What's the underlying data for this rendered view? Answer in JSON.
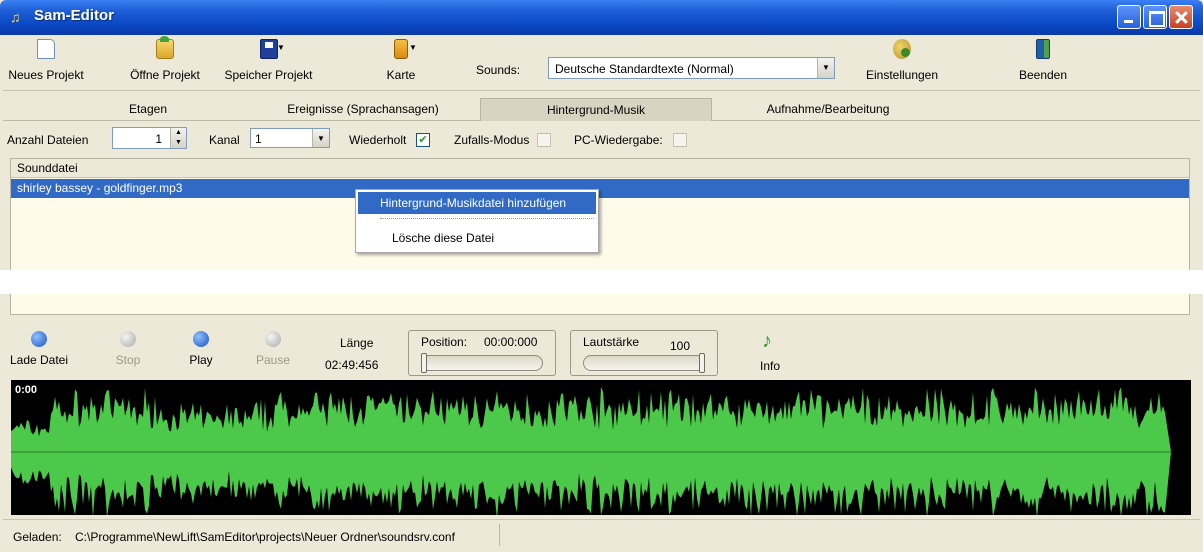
{
  "window": {
    "title": "Sam-Editor",
    "icon": "music-note-icon"
  },
  "toolbar": {
    "new_project": "Neues Projekt",
    "open_project": "Öffne Projekt",
    "save_project": "Speicher Projekt",
    "map": "Karte",
    "sounds_label": "Sounds:",
    "sounds_value": "Deutsche Standardtexte (Normal)",
    "settings": "Einstellungen",
    "exit": "Beenden"
  },
  "tabs": [
    {
      "label": "Etagen",
      "active": false
    },
    {
      "label": "Ereignisse (Sprachansagen)",
      "active": false
    },
    {
      "label": "Hintergrund-Musik",
      "active": true
    },
    {
      "label": "Aufnahme/Bearbeitung",
      "active": false
    }
  ],
  "options": {
    "file_count_label": "Anzahl Dateien",
    "file_count_value": "1",
    "channel_label": "Kanal",
    "channel_value": "1",
    "repeat_label": "Wiederholt",
    "repeat_checked": true,
    "random_label": "Zufalls-Modus",
    "random_checked": false,
    "pc_play_label": "PC-Wiedergabe:",
    "pc_play_checked": false
  },
  "list": {
    "header": "Sounddatei",
    "rows": [
      "shirley bassey - goldfinger.mp3"
    ]
  },
  "context_menu": {
    "items": [
      "Hintergrund-Musikdatei hinzufügen",
      "Lösche diese Datei"
    ]
  },
  "player": {
    "load": "Lade Datei",
    "stop": "Stop",
    "play": "Play",
    "pause": "Pause",
    "length_label": "Länge",
    "length_value": "02:49:456",
    "position_label": "Position:",
    "position_value": "00:00:000",
    "position_fraction": 0,
    "volume_label": "Lautstärke",
    "volume_value": "100",
    "volume_fraction": 1,
    "info": "Info"
  },
  "waveform": {
    "time_start": "0:00",
    "color": "#4cc94a"
  },
  "status": {
    "label": "Geladen:",
    "path": "C:\\Programme\\NewLift\\SamEditor\\projects\\Neuer Ordner\\soundsrv.conf"
  }
}
